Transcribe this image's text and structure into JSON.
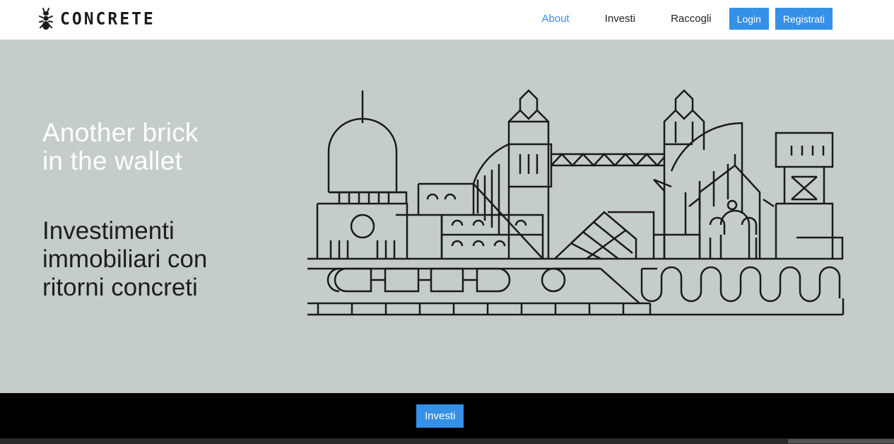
{
  "brand": {
    "name": "CONCRETE",
    "icon": "ant-icon"
  },
  "nav": {
    "about": "About",
    "investi": "Investi",
    "raccogli": "Raccogli",
    "login": "Login",
    "register": "Registrati"
  },
  "hero": {
    "headline_line1": "Another brick",
    "headline_line2": "in the wallet",
    "sub_line1": "Investimenti",
    "sub_line2": "immobiliari con",
    "sub_line3": "ritorni concreti",
    "illustration": "city-skyline-illustration"
  },
  "footer": {
    "cta": "Investi"
  },
  "colors": {
    "accent": "#3590e8",
    "hero_bg": "#c4cdcc",
    "active_link": "#3d8ee0"
  }
}
